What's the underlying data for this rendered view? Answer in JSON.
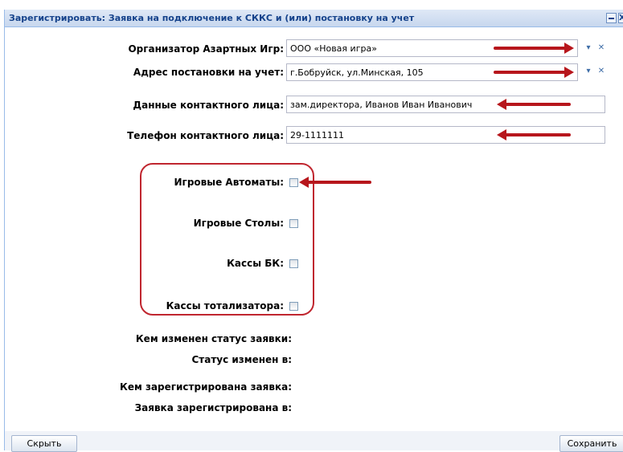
{
  "window": {
    "title": "Зарегистрировать: Заявка на подключение к СККС и (или) постановку на учет",
    "close_glyph": "X"
  },
  "form": {
    "organizer": {
      "label": "Организатор Азартных Игр:",
      "value": "ООО «Новая игра»"
    },
    "address": {
      "label": "Адрес постановки на учет:",
      "value": "г.Бобруйск, ул.Минская, 105"
    },
    "contact_person": {
      "label": "Данные контактного лица:",
      "value": "зам.директора, Иванов Иван Иванович"
    },
    "contact_phone": {
      "label": "Телефон контактного лица:",
      "value": "29-1111111"
    },
    "checkboxes": {
      "slot_machines": {
        "label": "Игровые Автоматы:",
        "checked": false
      },
      "game_tables": {
        "label": "Игровые Столы:",
        "checked": false
      },
      "bk_cashdesks": {
        "label": "Кассы БК:",
        "checked": false
      },
      "totalizator_cashdesks": {
        "label": "Кассы тотализатора:",
        "checked": false
      }
    },
    "status_changed_by": {
      "label": "Кем изменен статус заявки:"
    },
    "status_changed_at": {
      "label": "Статус изменен в:"
    },
    "registered_by": {
      "label": "Кем зарегистрирована заявка:"
    },
    "registered_at": {
      "label": "Заявка зарегистрирована в:"
    }
  },
  "icons": {
    "dropdown": "▾",
    "clear": "✕"
  },
  "buttons": {
    "hide": "Скрыть",
    "save": "Сохранить"
  },
  "colors": {
    "title_text": "#15428b",
    "annotation_red": "#b7161c"
  }
}
